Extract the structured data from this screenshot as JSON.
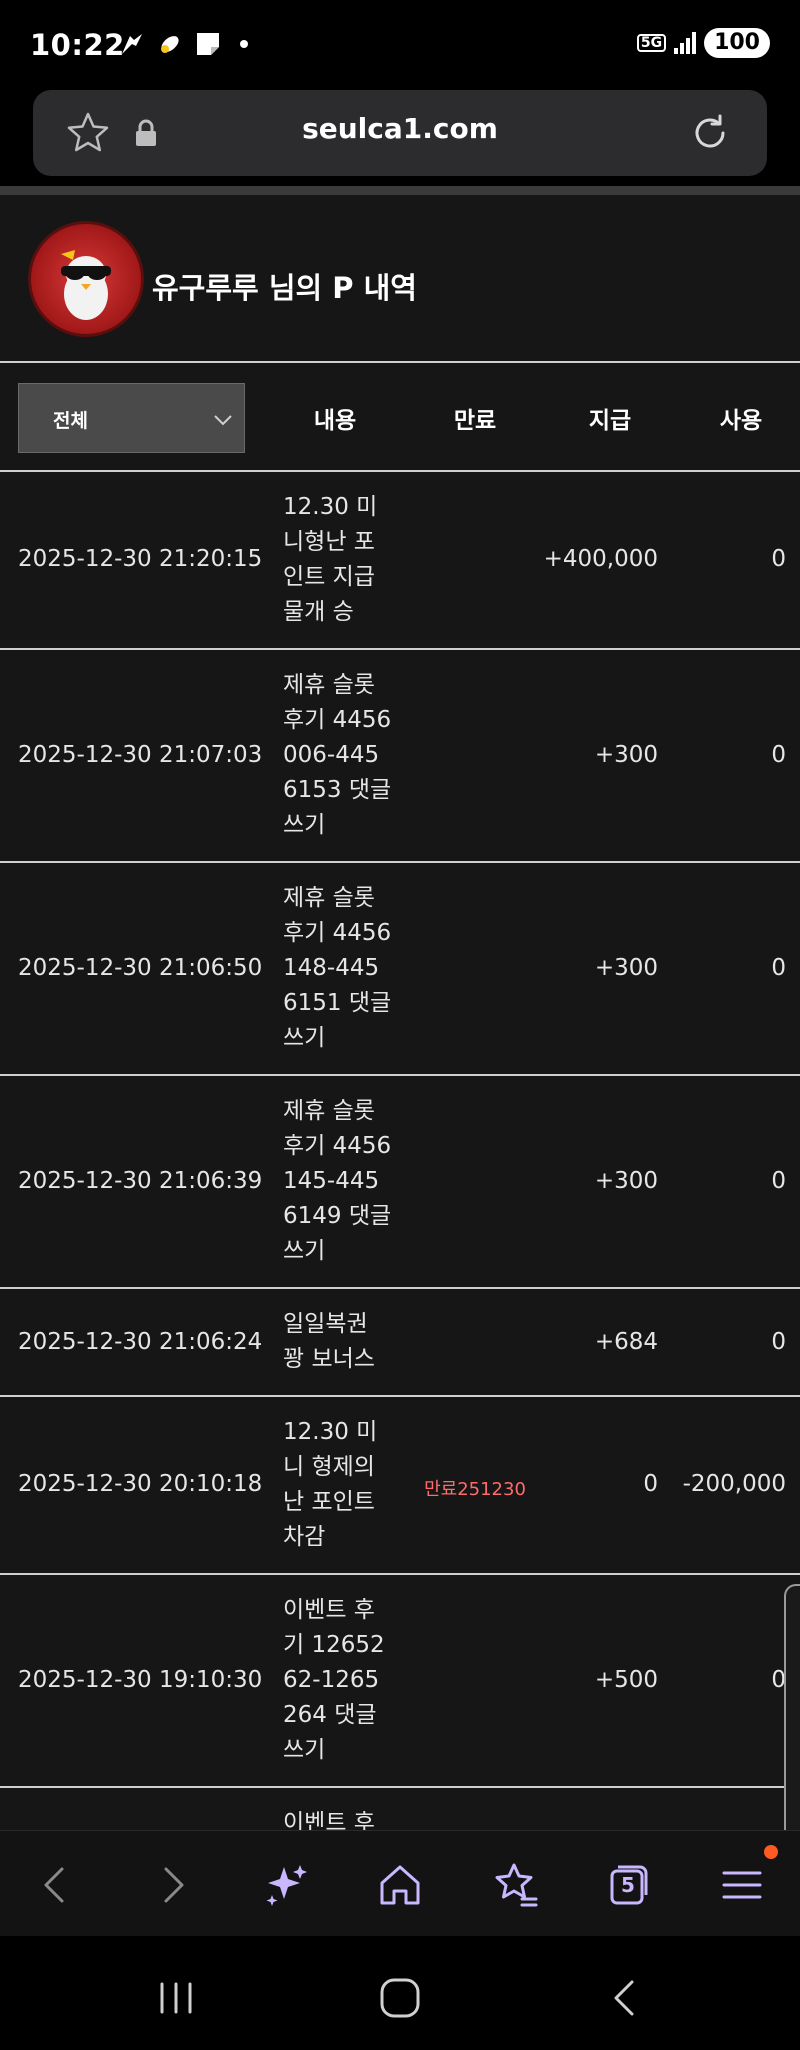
{
  "status_bar": {
    "time": "10:22",
    "network": "5G",
    "battery": "100",
    "icons": [
      "app-notification-icon",
      "app-notification-icon",
      "notes-icon",
      "more-notifications-dot"
    ]
  },
  "browser": {
    "url": "seulca1.com"
  },
  "profile": {
    "title": "유구루루 님의 P 내역"
  },
  "filter": {
    "selected": "전체"
  },
  "table": {
    "headers": {
      "content": "내용",
      "expiry": "만료",
      "give": "지급",
      "use": "사용"
    },
    "rows": [
      {
        "date": "2025-12-30 21:20:15",
        "desc": "12.30 미니형난 포인트 지급 물개 승",
        "expiry": "",
        "give": "+400,000",
        "use": "0"
      },
      {
        "date": "2025-12-30 21:07:03",
        "desc": "제휴 슬롯 후기 4456006-4456153 댓글쓰기",
        "expiry": "",
        "give": "+300",
        "use": "0"
      },
      {
        "date": "2025-12-30 21:06:50",
        "desc": "제휴 슬롯 후기 4456148-4456151 댓글쓰기",
        "expiry": "",
        "give": "+300",
        "use": "0"
      },
      {
        "date": "2025-12-30 21:06:39",
        "desc": "제휴 슬롯 후기 4456145-4456149 댓글쓰기",
        "expiry": "",
        "give": "+300",
        "use": "0"
      },
      {
        "date": "2025-12-30 21:06:24",
        "desc": "일일복권 꽝 보너스",
        "expiry": "",
        "give": "+684",
        "use": "0"
      },
      {
        "date": "2025-12-30 20:10:18",
        "desc": "12.30 미니 형제의 난 포인트 차감",
        "expiry": "만료251230",
        "give": "0",
        "use": "-200,000"
      },
      {
        "date": "2025-12-30 19:10:30",
        "desc": "이벤트 후기 1265262-1265264 댓글쓰기",
        "expiry": "",
        "give": "+500",
        "use": "0"
      },
      {
        "date": "",
        "desc": "이벤트 후",
        "expiry": "",
        "give": "",
        "use": ""
      }
    ]
  },
  "toolbar": {
    "tabs_count": "5"
  },
  "colors": {
    "background": "#161616",
    "expiry_text": "#ff6b6b",
    "badge": "#ff5a1f"
  }
}
